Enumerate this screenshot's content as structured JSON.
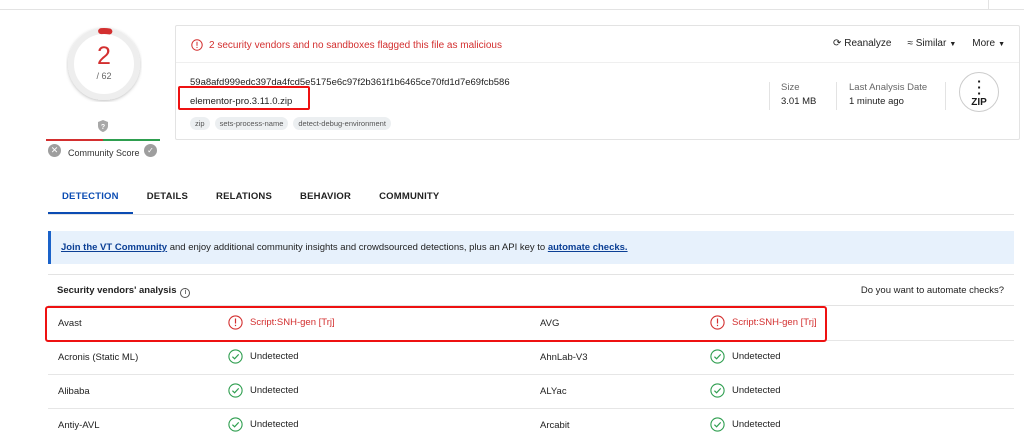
{
  "score": {
    "detections": "2",
    "total": "/ 62",
    "community_label": "Community Score",
    "detection_ratio": 0.032
  },
  "alert": {
    "text": "2 security vendors and no sandboxes flagged this file as malicious"
  },
  "actions": {
    "reanalyze": "Reanalyze",
    "similar": "Similar",
    "more": "More"
  },
  "file": {
    "hash": "59a8afd999edc397da4fcd5e5175e6c97f2b361f1b6465ce70fd1d7e69fcb586",
    "name": "elementor-pro.3.11.0.zip",
    "tags": [
      "zip",
      "sets-process-name",
      "detect-debug-environment"
    ],
    "size_label": "Size",
    "size_value": "3.01 MB",
    "date_label": "Last Analysis Date",
    "date_value": "1 minute ago",
    "type_icon_text": "ZIP"
  },
  "tabs": [
    "DETECTION",
    "DETAILS",
    "RELATIONS",
    "BEHAVIOR",
    "COMMUNITY"
  ],
  "banner": {
    "link1": "Join the VT Community",
    "middle": " and enjoy additional community insights and crowdsourced detections, plus an API key to ",
    "link2": "automate checks."
  },
  "analysis": {
    "title": "Security vendors' analysis",
    "automate": "Do you want to automate checks?",
    "rows": [
      {
        "v1": "Avast",
        "r1": "Script:SNH-gen [Trj]",
        "s1": "malicious",
        "v2": "AVG",
        "r2": "Script:SNH-gen [Trj]",
        "s2": "malicious"
      },
      {
        "v1": "Acronis (Static ML)",
        "r1": "Undetected",
        "s1": "clean",
        "v2": "AhnLab-V3",
        "r2": "Undetected",
        "s2": "clean"
      },
      {
        "v1": "Alibaba",
        "r1": "Undetected",
        "s1": "clean",
        "v2": "ALYac",
        "r2": "Undetected",
        "s2": "clean"
      },
      {
        "v1": "Antiy-AVL",
        "r1": "Undetected",
        "s1": "clean",
        "v2": "Arcabit",
        "r2": "Undetected",
        "s2": "clean"
      }
    ]
  },
  "colors": {
    "malicious": "#d32f2f",
    "clean": "#2e9e4f",
    "accent": "#0b4cb3",
    "highlight": "#e11111"
  }
}
